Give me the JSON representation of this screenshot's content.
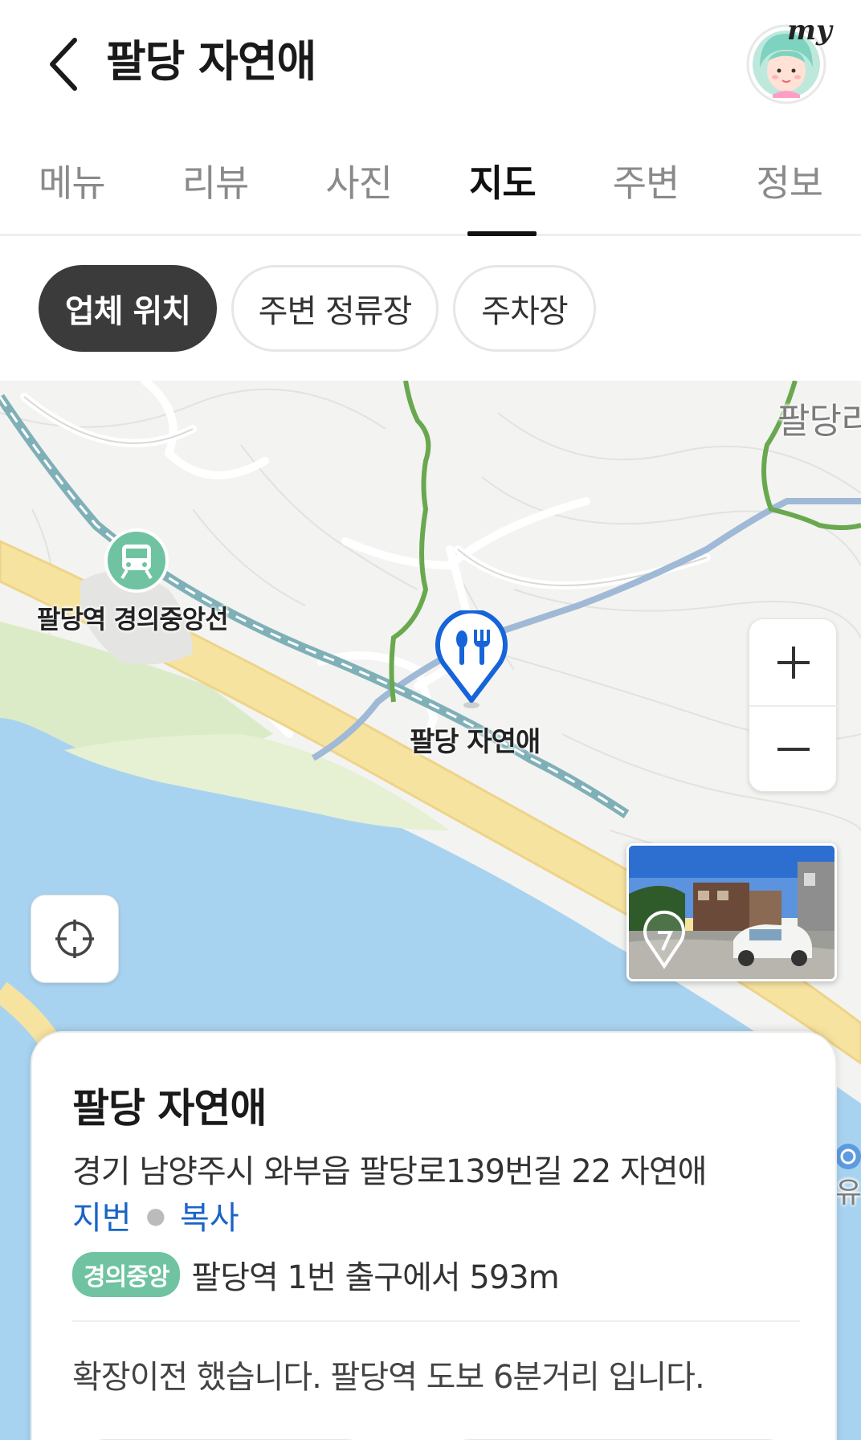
{
  "header": {
    "title": "팔당 자연애",
    "avatar_label": "my"
  },
  "tabs": [
    {
      "label": "메뉴",
      "active": false
    },
    {
      "label": "리뷰",
      "active": false
    },
    {
      "label": "사진",
      "active": false
    },
    {
      "label": "지도",
      "active": true
    },
    {
      "label": "주변",
      "active": false
    },
    {
      "label": "정보",
      "active": false
    }
  ],
  "chips": [
    {
      "label": "업체 위치",
      "active": true
    },
    {
      "label": "주변 정류장",
      "active": false
    },
    {
      "label": "주차장",
      "active": false
    }
  ],
  "map": {
    "station_label": "팔당역 경의중앙선",
    "place_label": "팔당 자연애",
    "corner_label": "팔당리",
    "edge_label": "유",
    "zoom_in": "+",
    "zoom_out": "−"
  },
  "card": {
    "title": "팔당 자연애",
    "address": "경기 남양주시 와부읍 팔당로139번길 22 자연애",
    "lot_link": "지번",
    "copy_link": "복사",
    "line_badge": "경의중앙",
    "transit_text": "팔당역 1번 출구에서 593m",
    "description": "확장이전 했습니다. 팔당역 도보 6분거리 입니다."
  },
  "colors": {
    "accent_blue": "#1a64c8",
    "line_green": "#6fc3a1",
    "water": "#a8d3f0",
    "highway": "#f7e3a0",
    "trail": "#6aa84f"
  }
}
